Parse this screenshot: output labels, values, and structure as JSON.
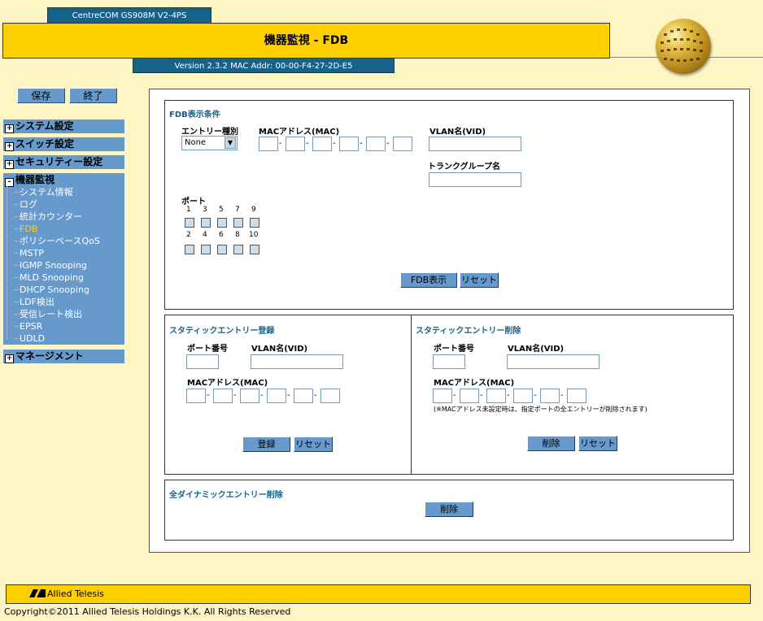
{
  "header": {
    "model": "CentreCOM GS908M V2-4PS",
    "title": "機器監視 - FDB",
    "version": "Version 2.3.2 MAC Addr: 00-00-F4-27-2D-E5"
  },
  "sidebar": {
    "save_label": "保存",
    "exit_label": "終了",
    "menus": [
      {
        "label": "システム設定",
        "toggle": "+"
      },
      {
        "label": "スイッチ設定",
        "toggle": "+"
      },
      {
        "label": "セキュリティー設定",
        "toggle": "+"
      },
      {
        "label": "機器監視",
        "toggle": "-"
      },
      {
        "label": "マネージメント",
        "toggle": "+"
      }
    ],
    "monitor_items": [
      "システム情報",
      "ログ",
      "統計カウンター",
      "FDB",
      "ポリシーベースQoS",
      "MSTP",
      "IGMP Snooping",
      "MLD Snooping",
      "DHCP Snooping",
      "LDF検出",
      "受信レート検出",
      "EPSR",
      "UDLD"
    ],
    "active_item": "FDB"
  },
  "fdb_display": {
    "title": "FDB表示条件",
    "entry_type_label": "エントリー種別",
    "entry_type_value": "None",
    "mac_label": "MACアドレス(MAC)",
    "vlan_label": "VLAN名(VID)",
    "trunk_label": "トランクグループ名",
    "port_label": "ポート",
    "ports_top": [
      "1",
      "3",
      "5",
      "7",
      "9"
    ],
    "ports_bottom": [
      "2",
      "4",
      "6",
      "8",
      "10"
    ],
    "show_button": "FDB表示",
    "reset_button": "リセット"
  },
  "static_register": {
    "title": "スタティックエントリー登録",
    "port_label": "ポート番号",
    "vlan_label": "VLAN名(VID)",
    "mac_label": "MACアドレス(MAC)",
    "register_button": "登録",
    "reset_button": "リセット"
  },
  "static_delete": {
    "title": "スタティックエントリー削除",
    "port_label": "ポート番号",
    "vlan_label": "VLAN名(VID)",
    "mac_label": "MACアドレス(MAC)",
    "note": "(※MACアドレス未設定時は、指定ポートの全エントリーが削除されます)",
    "delete_button": "削除",
    "reset_button": "リセット"
  },
  "dynamic_delete": {
    "title": "全ダイナミックエントリー削除",
    "delete_button": "削除"
  },
  "footer": {
    "logo": "Allied Telesis",
    "copyright": "Copyright©2011 Allied Telesis Holdings K.K. All Rights Reserved"
  },
  "colors": {
    "accent_yellow": "#ffd000",
    "header_blue": "#18628a",
    "menu_blue": "#6699cc",
    "background": "#fdf5c4"
  }
}
